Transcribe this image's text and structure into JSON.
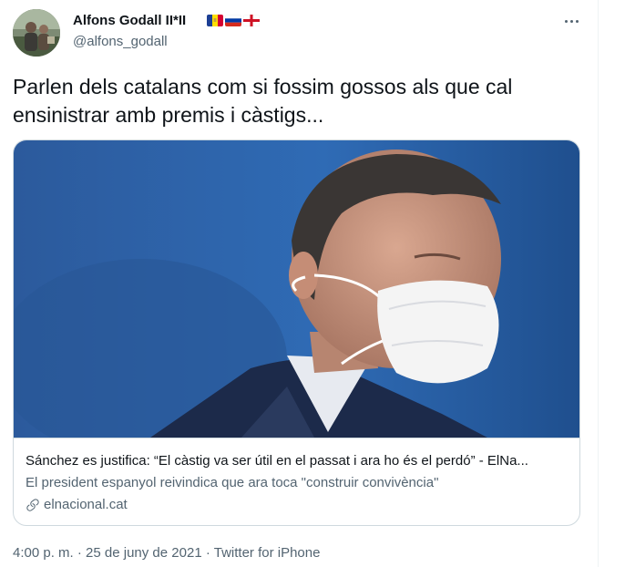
{
  "author": {
    "display_name": "Alfons Godall II*II",
    "handle": "@alfons_godall",
    "flags": [
      "andorra-flag",
      "russia-flag",
      "england-flag"
    ]
  },
  "tweet": {
    "text": "Parlen dels catalans com si fossim gossos als que cal ensinistrar amb premis i càstigs..."
  },
  "card": {
    "title": "Sánchez es justifica: “El càstig va ser útil en el passat i ara ho és el perdó” - ElNa...",
    "description": "El president espanyol reivindica que ara toca \"construir convivència\"",
    "domain": "elnacional.cat",
    "icon": "link-icon"
  },
  "meta": {
    "time": "4:00 p. m.",
    "separator1": " · ",
    "date": "25 de juny de 2021",
    "separator2": " · ",
    "source": "Twitter for iPhone"
  },
  "colors": {
    "text": "#0f1419",
    "secondary": "#536471",
    "border": "#cfd9de"
  }
}
